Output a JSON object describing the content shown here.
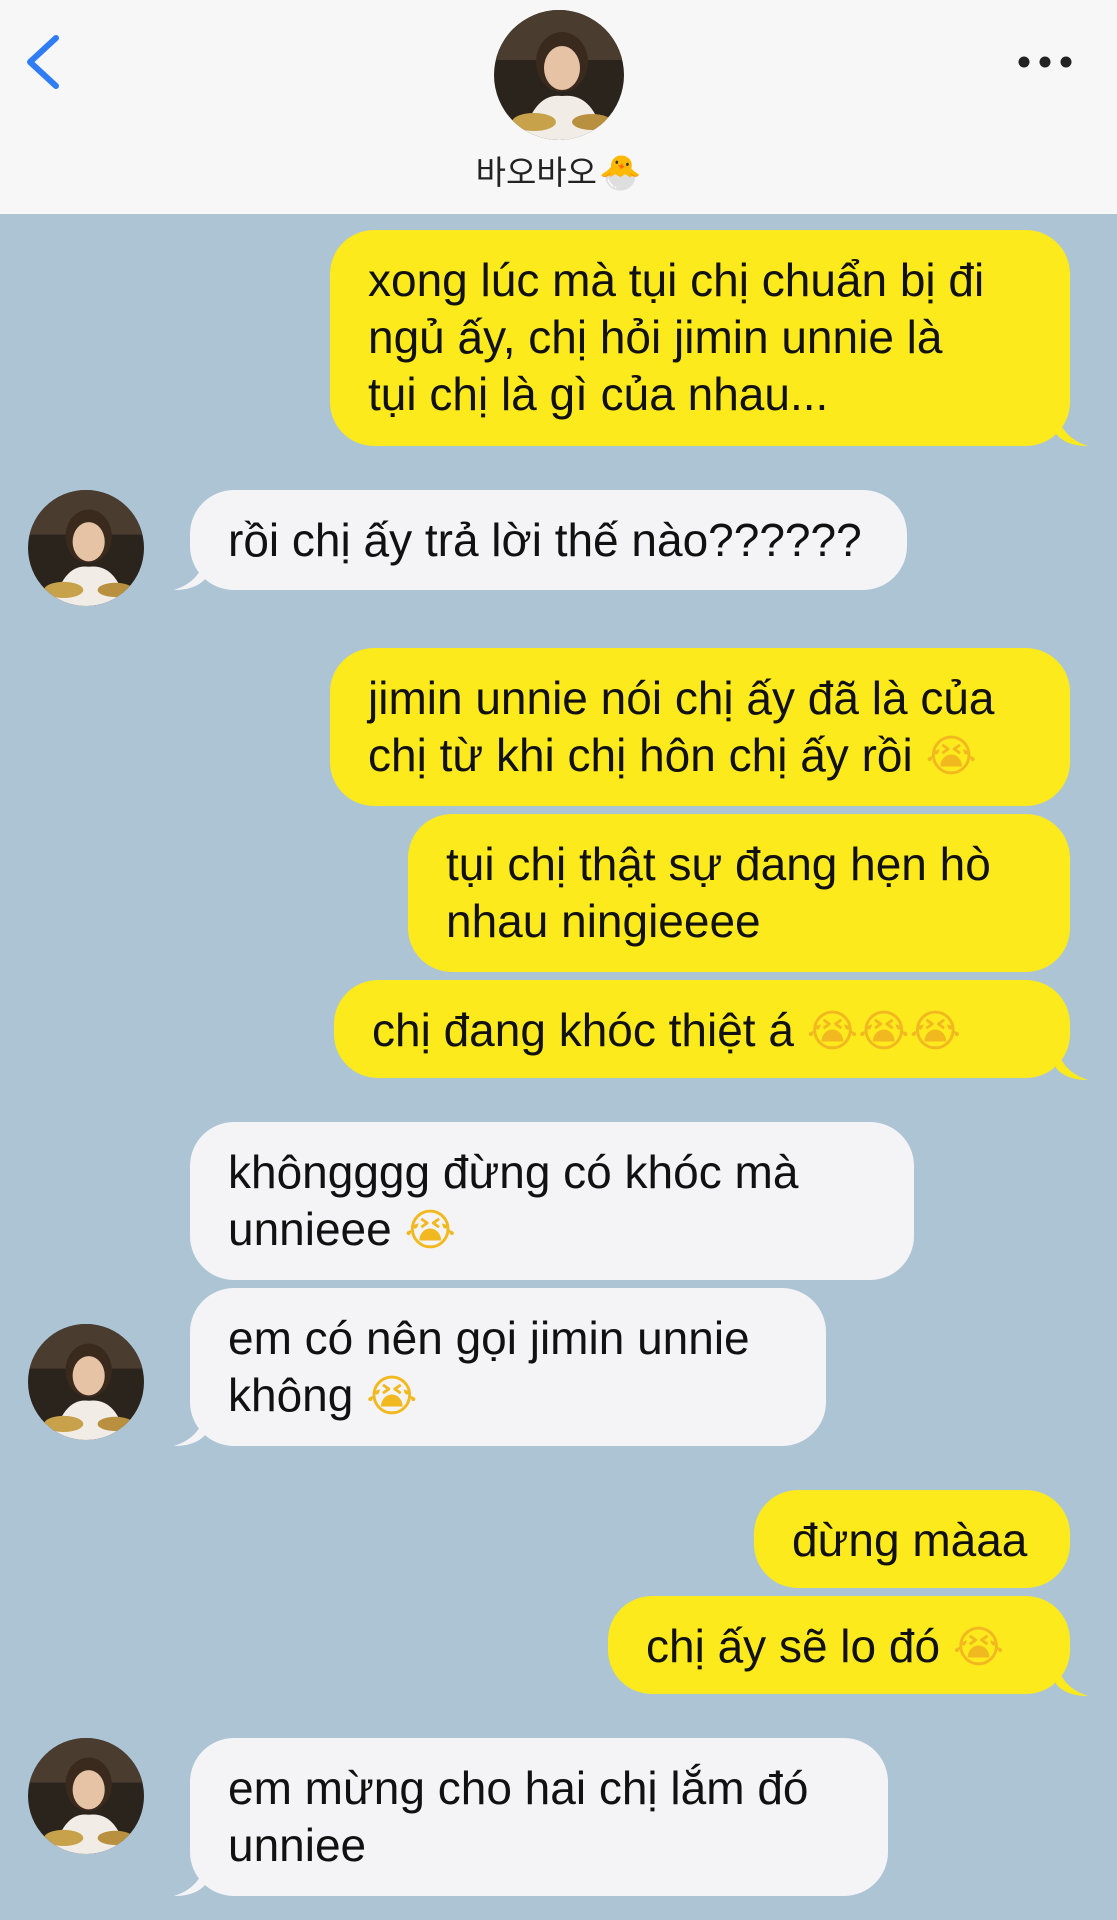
{
  "header": {
    "back_icon": "chevron-left-icon",
    "more_icon": "more-horizontal-icon",
    "contact_name": "바오바오",
    "contact_emoji": "🐣"
  },
  "colors": {
    "background": "#adc4d5",
    "outgoing_bubble": "#fcea1c",
    "incoming_bubble": "#f4f4f6",
    "accent": "#2f7cf6"
  },
  "messages": [
    {
      "from": "me",
      "lines": [
        "xong lúc mà tụi chị chuẩn bị đi",
        "ngủ ấy, chị hỏi jimin unnie là",
        "tụi chị là gì của nhau..."
      ]
    },
    {
      "from": "them",
      "lines": [
        "rồi chị ấy trả lời thế nào??????"
      ]
    },
    {
      "from": "me",
      "lines": [
        "jimin unnie nói chị ấy đã là của",
        "chị từ khi chị hôn chị ấy rồi"
      ]
    },
    {
      "from": "me",
      "lines": [
        "tụi chị thật sự đang hẹn hò",
        "nhau ningieeee"
      ]
    },
    {
      "from": "me",
      "lines": [
        "chị đang khóc thiệt á"
      ]
    },
    {
      "from": "them",
      "lines": [
        "khôngggg đừng có khóc mà",
        "unnieee"
      ]
    },
    {
      "from": "them",
      "lines": [
        "em có nên gọi jimin unnie",
        "không"
      ]
    },
    {
      "from": "me",
      "lines": [
        "đừng màaa"
      ]
    },
    {
      "from": "me",
      "lines": [
        "chị ấy sẽ lo đó"
      ]
    },
    {
      "from": "them",
      "lines": [
        "em mừng cho hai chị lắm đó",
        "unniee"
      ]
    }
  ]
}
